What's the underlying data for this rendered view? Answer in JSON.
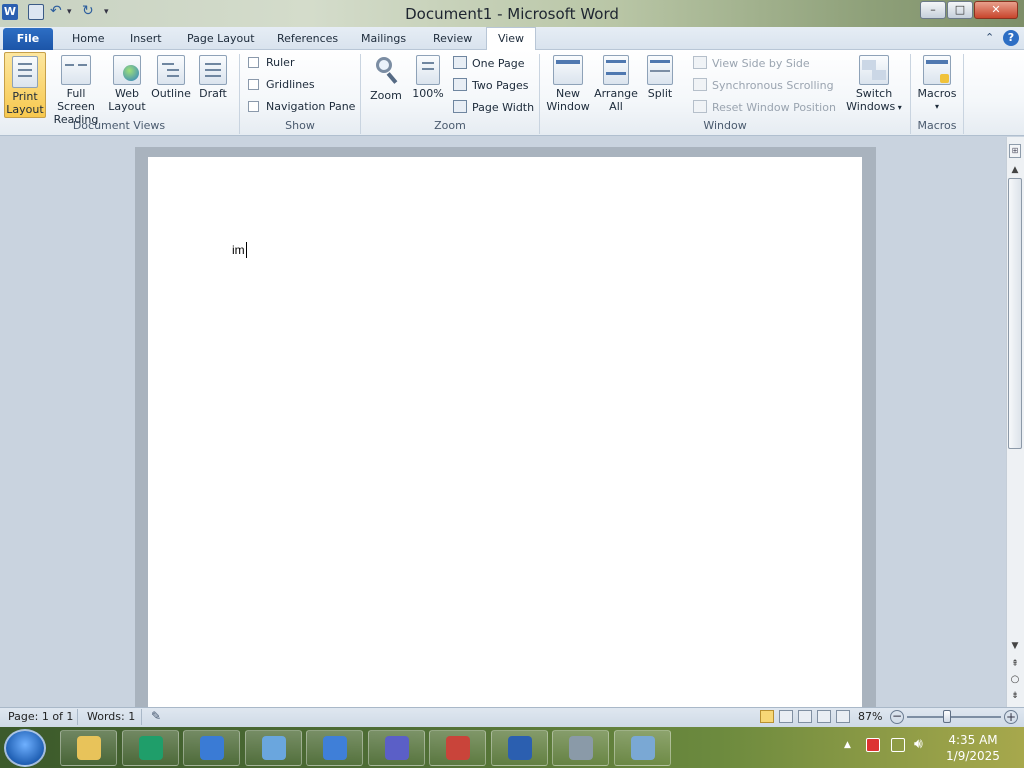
{
  "window": {
    "title": "Document1  -  Microsoft Word",
    "controls": {
      "minimize": "–",
      "maximize": "□",
      "close": "✕"
    }
  },
  "tabs": [
    {
      "label": "File"
    },
    {
      "label": "Home"
    },
    {
      "label": "Insert"
    },
    {
      "label": "Page Layout"
    },
    {
      "label": "References"
    },
    {
      "label": "Mailings"
    },
    {
      "label": "Review"
    },
    {
      "label": "View",
      "selected": true
    }
  ],
  "ribbon": {
    "document_views": {
      "label": "Document Views",
      "buttons": [
        "Print Layout",
        "Full Screen Reading",
        "Web Layout",
        "Outline",
        "Draft"
      ],
      "button_lines": [
        [
          "Print",
          "Layout"
        ],
        [
          "Full Screen",
          "Reading"
        ],
        [
          "Web",
          "Layout"
        ],
        [
          "Outline"
        ],
        [
          "Draft"
        ]
      ]
    },
    "show": {
      "label": "Show",
      "checkboxes": [
        {
          "label": "Ruler",
          "checked": false
        },
        {
          "label": "Gridlines",
          "checked": false
        },
        {
          "label": "Navigation Pane",
          "checked": false
        }
      ]
    },
    "zoom": {
      "label": "Zoom",
      "zoom_button": "Zoom",
      "hundred_button": "100%",
      "one_page": "One Page",
      "two_pages": "Two Pages",
      "page_width": "Page Width"
    },
    "window": {
      "label": "Window",
      "new_window": [
        "New",
        "Window"
      ],
      "arrange_all": [
        "Arrange",
        "All"
      ],
      "split": "Split",
      "view_side_by_side": "View Side by Side",
      "synchronous_scrolling": "Synchronous Scrolling",
      "reset_window_position": "Reset Window Position",
      "switch_windows": [
        "Switch",
        "Windows"
      ]
    },
    "macros": {
      "label": "Macros",
      "button": "Macros"
    }
  },
  "document": {
    "text": "im"
  },
  "status": {
    "page": "Page: 1 of 1",
    "words": "Words: 1",
    "zoom": "87%",
    "zoom_fraction": 0.87
  },
  "taskbar": {
    "time": "4:35 AM",
    "date": "1/9/2025",
    "apps": [
      {
        "name": "file-explorer-icon",
        "color": "#e8c35a"
      },
      {
        "name": "edge-icon",
        "color": "#1f9e6a"
      },
      {
        "name": "browser-icon",
        "color": "#3a7bd5"
      },
      {
        "name": "control-panel-icon",
        "color": "#6aa6de"
      },
      {
        "name": "usb-app-icon",
        "color": "#3f7fd8"
      },
      {
        "name": "game-icon",
        "color": "#5b5fc7"
      },
      {
        "name": "paint-icon",
        "color": "#c9443a"
      },
      {
        "name": "word-icon",
        "color": "#2b5fb0"
      },
      {
        "name": "media-center-icon",
        "color": "#8a9aa8"
      },
      {
        "name": "network-app-icon",
        "color": "#7aa8d4"
      }
    ]
  },
  "colors": {
    "file_tab": "#1c55a8",
    "active_view": "#f7c84e",
    "word_blue": "#2b5fb0"
  }
}
